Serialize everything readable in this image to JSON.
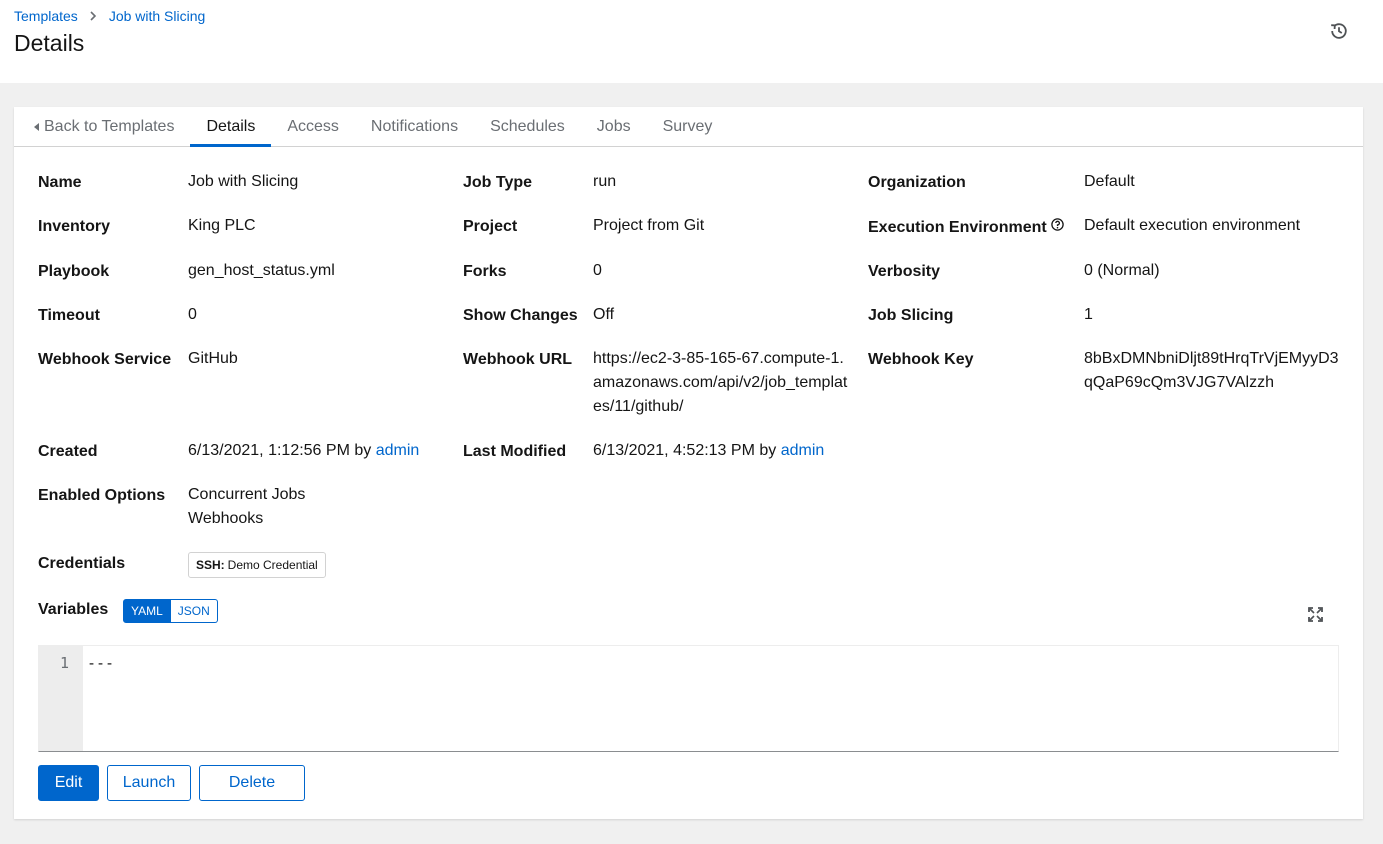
{
  "breadcrumb": {
    "root": "Templates",
    "current": "Job with Slicing"
  },
  "header": {
    "title": "Details",
    "history_icon": "history-icon"
  },
  "tabs": {
    "back": "Back to Templates",
    "items": [
      "Details",
      "Access",
      "Notifications",
      "Schedules",
      "Jobs",
      "Survey"
    ],
    "active": "Details"
  },
  "details": {
    "name": {
      "label": "Name",
      "value": "Job with Slicing"
    },
    "job_type": {
      "label": "Job Type",
      "value": "run"
    },
    "organization": {
      "label": "Organization",
      "value": "Default"
    },
    "inventory": {
      "label": "Inventory",
      "value": "King PLC"
    },
    "project": {
      "label": "Project",
      "value": "Project from Git"
    },
    "execution_environment": {
      "label": "Execution Environment",
      "value": "Default execution environment"
    },
    "playbook": {
      "label": "Playbook",
      "value": "gen_host_status.yml"
    },
    "forks": {
      "label": "Forks",
      "value": "0"
    },
    "verbosity": {
      "label": "Verbosity",
      "value": "0 (Normal)"
    },
    "timeout": {
      "label": "Timeout",
      "value": "0"
    },
    "show_changes": {
      "label": "Show Changes",
      "value": "Off"
    },
    "job_slicing": {
      "label": "Job Slicing",
      "value": "1"
    },
    "webhook_service": {
      "label": "Webhook Service",
      "value": "GitHub"
    },
    "webhook_url": {
      "label": "Webhook URL",
      "value": "https://ec2-3-85-165-67.compute-1.amazonaws.com/api/v2/job_templates/11/github/"
    },
    "webhook_key": {
      "label": "Webhook Key",
      "value": "8bBxDMNbniDljt89tHrqTrVjEMyyD3qQaP69cQm3VJG7VAlzzh"
    },
    "created": {
      "label": "Created",
      "date": "6/13/2021, 1:12:56 PM by",
      "user": "admin"
    },
    "last_modified": {
      "label": "Last Modified",
      "date": "6/13/2021, 4:52:13 PM by",
      "user": "admin"
    },
    "enabled_options": {
      "label": "Enabled Options",
      "values": [
        "Concurrent Jobs",
        "Webhooks"
      ]
    },
    "credentials": {
      "label": "Credentials",
      "kind": "SSH:",
      "name": "Demo Credential"
    }
  },
  "variables": {
    "label": "Variables",
    "modes": [
      "YAML",
      "JSON"
    ],
    "active_mode": "YAML",
    "line_number": "1",
    "content": "---"
  },
  "actions": {
    "edit": "Edit",
    "launch": "Launch",
    "delete": "Delete"
  },
  "colors": {
    "link": "#0066cc",
    "background": "#f0f0f0",
    "text": "#151515",
    "muted": "#6a6e73"
  }
}
